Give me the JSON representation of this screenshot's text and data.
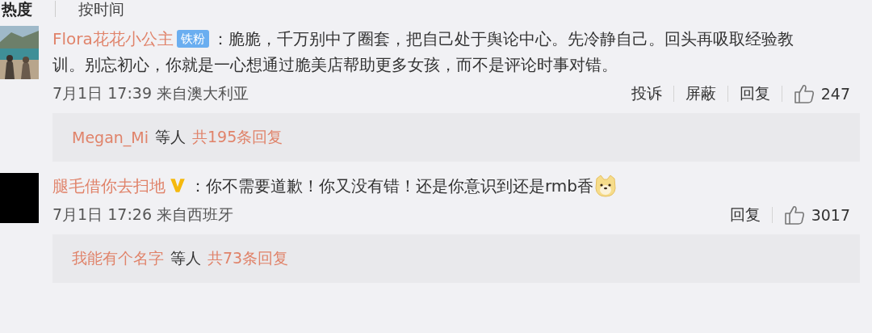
{
  "sort_tabs": [
    {
      "label": "热度",
      "selected": true
    },
    {
      "label": "按时间",
      "selected": false
    }
  ],
  "comments": [
    {
      "name": "Flora花花小公主",
      "badge": {
        "kind": "fan",
        "label": "铁粉"
      },
      "text": "：脆脆，千万别中了圈套，把自己处于舆论中心。先冷静自己。回头再吸取经验教训。别忘初心，你就是一心想通过脆美店帮助更多女孩，而不是评论时事对错。",
      "emoji": false,
      "date": "7月1日 17:39",
      "location": "来自澳大利亚",
      "actions": [
        "投诉",
        "屏蔽",
        "回复"
      ],
      "likes": "247",
      "replies": {
        "user": "Megan_Mi",
        "middle": "等人",
        "count": "共195条回复"
      }
    },
    {
      "avatar": {
        "kind": "dark"
      },
      "name": "腿毛借你去扫地",
      "badge": {
        "kind": "verified"
      },
      "text": "：你不需要道歉！你又没有错！还是你意识到还是rmb香",
      "emoji": true,
      "date": "7月1日 17:26",
      "location": "来自西班牙",
      "actions": [
        "回复"
      ],
      "likes": "3017",
      "replies": {
        "user": "我能有个名字",
        "middle": "等人",
        "count": "共73条回复"
      }
    }
  ]
}
